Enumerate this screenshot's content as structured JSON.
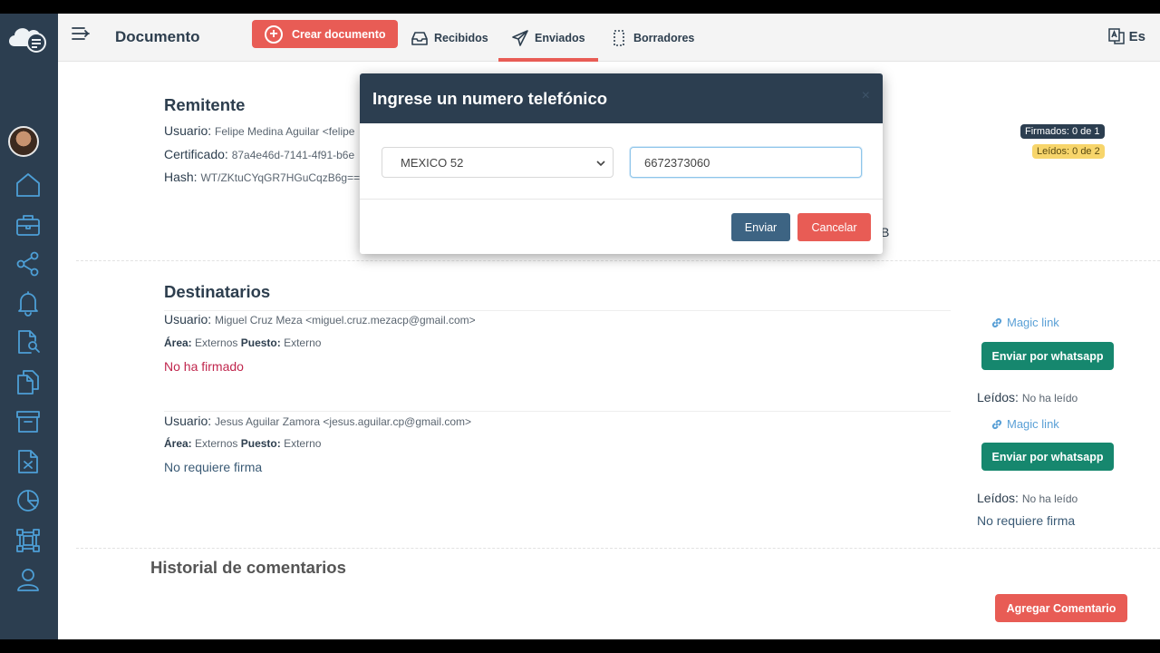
{
  "header": {
    "page_title": "Documento",
    "create_label": "Crear documento",
    "tabs": [
      {
        "label": "Recibidos",
        "icon": "inbox-icon"
      },
      {
        "label": "Enviados",
        "icon": "send-icon",
        "active": true
      },
      {
        "label": "Borradores",
        "icon": "draft-icon"
      }
    ],
    "lang_label": "Es"
  },
  "sidebar": {
    "items": [
      "home-icon",
      "briefcase-icon",
      "share-icon",
      "bell-icon",
      "document-search-icon",
      "copy-icon",
      "archive-icon",
      "document-x-icon",
      "pie-chart-icon",
      "workflow-icon",
      "user-icon"
    ]
  },
  "sender": {
    "title": "Remitente",
    "user_label": "Usuario:",
    "user_value": "Felipe Medina Aguilar <felipe",
    "cert_label": "Certificado:",
    "cert_value": "87a4e46d-7141-4f91-b6e",
    "hash_label": "Hash:",
    "hash_value": "WT/ZKtuCYqGR7HGuCqzB6g==",
    "badge_signed": "Firmados: 0 de 1",
    "badge_read": "Leídos: 0 de 2",
    "stray_char": "B"
  },
  "recipients": {
    "title": "Destinatarios",
    "items": [
      {
        "user_label": "Usuario:",
        "user_value": "Miguel Cruz Meza <miguel.cruz.mezacp@gmail.com>",
        "area_label": "Área:",
        "area_value": "Externos",
        "post_label": "Puesto:",
        "post_value": "Externo",
        "status": "No ha firmado",
        "magic_link": "Magic link",
        "wa_button": "Enviar por whatsapp",
        "read_label": "Leídos:",
        "read_value": "No ha leído"
      },
      {
        "user_label": "Usuario:",
        "user_value": "Jesus Aguilar Zamora <jesus.aguilar.cp@gmail.com>",
        "area_label": "Área:",
        "area_value": "Externos",
        "post_label": "Puesto:",
        "post_value": "Externo",
        "status": "No requiere firma",
        "magic_link": "Magic link",
        "wa_button": "Enviar por whatsapp",
        "read_label": "Leídos:",
        "read_value": "No ha leído",
        "status_right": "No requiere firma"
      }
    ]
  },
  "comments": {
    "title": "Historial de comentarios",
    "add_button": "Agregar Comentario"
  },
  "modal": {
    "title": "Ingrese un numero telefónico",
    "close": "×",
    "country_value": "MEXICO 52",
    "phone_value": "6672373060",
    "send_label": "Enviar",
    "cancel_label": "Cancelar"
  },
  "colors": {
    "sidebar": "#2c3e50",
    "accent": "#e85c55",
    "whatsapp": "#16876e",
    "primary_button": "#3d6483"
  }
}
